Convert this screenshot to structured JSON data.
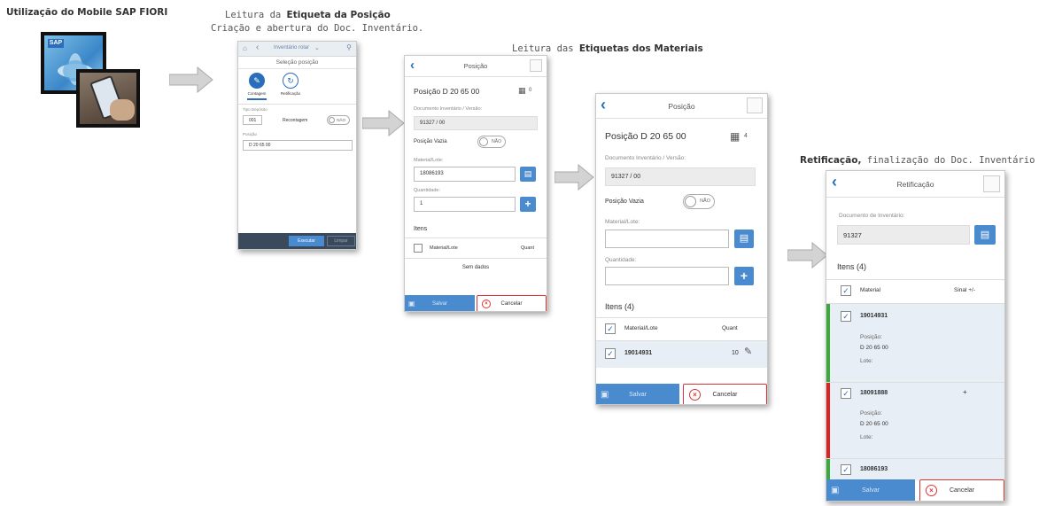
{
  "captions": {
    "step1": "Utilização do Mobile SAP FIORI",
    "step2_prefix": "Leitura da ",
    "step2_bold": "Etiqueta da Posição",
    "step2_line2": "Criação e abertura do Doc. Inventário.",
    "step3_prefix": "Leitura das ",
    "step3_bold": "Etiquetas dos Materiais",
    "step4_bold": "Retificação,",
    "step4_suffix": " finalização do Doc. Inventário"
  },
  "app_icon": {
    "label": "SAP"
  },
  "screen1": {
    "title": "Inventário rolar",
    "subtitle": "Seleção posição",
    "tab1": "Contagem",
    "tab2": "Retificação",
    "tipo_label": "Tipo Depósito",
    "tipo_value": "001",
    "recontagem_label": "Recontagem",
    "toggle": "NÃO",
    "posicao_label": "Posição",
    "posicao_value": "D 20 65 00",
    "btn_executar": "Executar",
    "btn_limpar": "Limpar"
  },
  "screen2": {
    "title": "Posição",
    "heading": "Posição D 20 65 00",
    "count": "0",
    "doc_label": "Documento Inventário / Versão:",
    "doc_value": "91327 / 00",
    "vazia_label": "Posição Vazia",
    "toggle": "NÃO",
    "material_label": "Material/Lote:",
    "material_value": "18086193",
    "qtd_label": "Quantidade:",
    "qtd_value": "1",
    "itens_label": "Itens",
    "col_material": "Material/Lote",
    "col_quant": "Quant",
    "empty": "Sem dados",
    "save": "Salvar",
    "cancel": "Cancelar"
  },
  "screen3": {
    "title": "Posição",
    "heading": "Posição D 20 65 00",
    "count": "4",
    "doc_label": "Documento Inventário / Versão:",
    "doc_value": "91327 / 00",
    "vazia_label": "Posição Vazia",
    "toggle": "NÃO",
    "material_label": "Material/Lote:",
    "qtd_label": "Quantidade:",
    "itens_label": "Itens (4)",
    "col_material": "Material/Lote",
    "col_quant": "Quant",
    "row1_material": "19014931",
    "row1_qty": "10",
    "save": "Salvar",
    "cancel": "Cancelar"
  },
  "screen4": {
    "title": "Retificação",
    "doc_label": "Documento de Inventário:",
    "doc_value": "91327",
    "itens_label": "Itens (4)",
    "col_material": "Material",
    "col_sinal": "Sinal +/-",
    "items": [
      {
        "material": "19014931",
        "pos_label": "Posição:",
        "pos_value": "D 20 65 00",
        "lote_label": "Lote:",
        "sinal": ""
      },
      {
        "material": "18091888",
        "pos_label": "Posição:",
        "pos_value": "D 20 65 00",
        "lote_label": "Lote:",
        "sinal": "+"
      },
      {
        "material": "18086193"
      }
    ],
    "save": "Salvar",
    "cancel": "Cancelar"
  },
  "colors": {
    "accent": "#4a8bd0",
    "danger": "#d33333",
    "ok": "#3aaa3a"
  }
}
